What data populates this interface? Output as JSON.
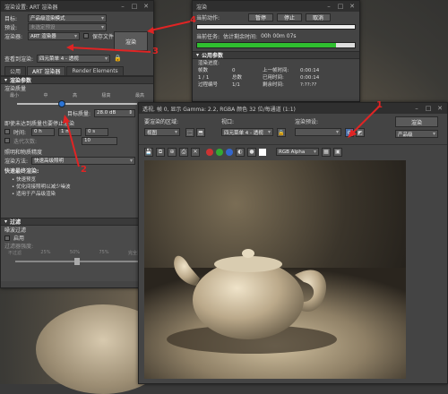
{
  "render_setup": {
    "title": "渲染设置: ART 渲染器",
    "target_label": "目标:",
    "target_value": "产品级渲染模式",
    "preset_label": "预设:",
    "preset_value": "未选定预设",
    "renderer_label": "渲染器:",
    "renderer_value": "ART 渲染器",
    "save_file_label": "保存文件",
    "render_button": "渲染",
    "view_label": "查看到渲染:",
    "view_value": "四元菜单 4 - 透视",
    "tabs": [
      "公用",
      "ART 渲染器",
      "Render Elements"
    ],
    "params_header": "渲染参数",
    "quality_header": "渲染质量",
    "quality_ticks": [
      "最小",
      "中",
      "高",
      "极高",
      "最高"
    ],
    "target_quality_label": "目标质量:",
    "target_quality_value": "28.0 dB",
    "stop_condition_label": "即使未达到质量也要停止渲染",
    "time_label": "时间:",
    "time_h": "0 h",
    "time_m": "1 m",
    "time_s": "0 s",
    "iterations_label": "迭代次数:",
    "iterations_value": "10",
    "lighting_header": "照明和物质精度",
    "method_label": "渲染方法:",
    "method_value": "快速高级照明",
    "fast_preset_header": "快速最终渲染:",
    "bullets": [
      "• 快速预览",
      "• 优化间接照明以减少噪波",
      "• 适用于产品级渲染"
    ],
    "filter_header": "过滤",
    "noise_filter_label": "噪波过滤",
    "enable_label": "启用",
    "filter_strength_label": "过滤器强度:",
    "strength_ticks": [
      "不过滤",
      "25%",
      "50%",
      "75%",
      "完全过滤"
    ],
    "strength_value": 0.5
  },
  "render_progress": {
    "title": "渲染",
    "current_action_label": "当前动作:",
    "pause_button": "暂停",
    "stop_button": "停止",
    "cancel_button": "取消",
    "current_task_label": "当前任务:",
    "estimated_time_label": "估计剩余时间:",
    "estimated_time_value": "00h 00m 07s",
    "progress": 0.88,
    "common_params_header": "公用参数",
    "render_progress_label": "渲染进度:",
    "frame_label": "帧数",
    "frame_value": "0",
    "total_label": "总数",
    "last_frame_time_label": "上一帧时间:",
    "last_frame_time_value": "0:00:14",
    "elapsed_label": "已用时间:",
    "elapsed_value": "0:00:14",
    "pass_label": "过程编号",
    "pass_value": "1/1",
    "remaining_label": "剩余时间:",
    "remaining_value": "?:??:??",
    "count_value": "1 / 1",
    "unknown_label": "未知"
  },
  "frame_window": {
    "title": "透视, 帧 0, 显示 Gamma: 2.2, RGBA 颜色 32 位/每通道 (1:1)",
    "area_label": "要渲染的区域:",
    "area_value": "视图",
    "viewport_label": "视口:",
    "viewport_value": "四元菜单 4 - 透视",
    "preset_label": "渲染预设:",
    "preset_value": "",
    "render_button": "渲染",
    "mode_value": "产品级",
    "channel_value": "RGB Alpha",
    "color_dots": [
      "#cc3333",
      "#33aa33",
      "#3366cc"
    ]
  },
  "annotations": {
    "n1": "1",
    "n2": "2",
    "n3": "3",
    "n4": "4",
    "red": "#e02424"
  }
}
